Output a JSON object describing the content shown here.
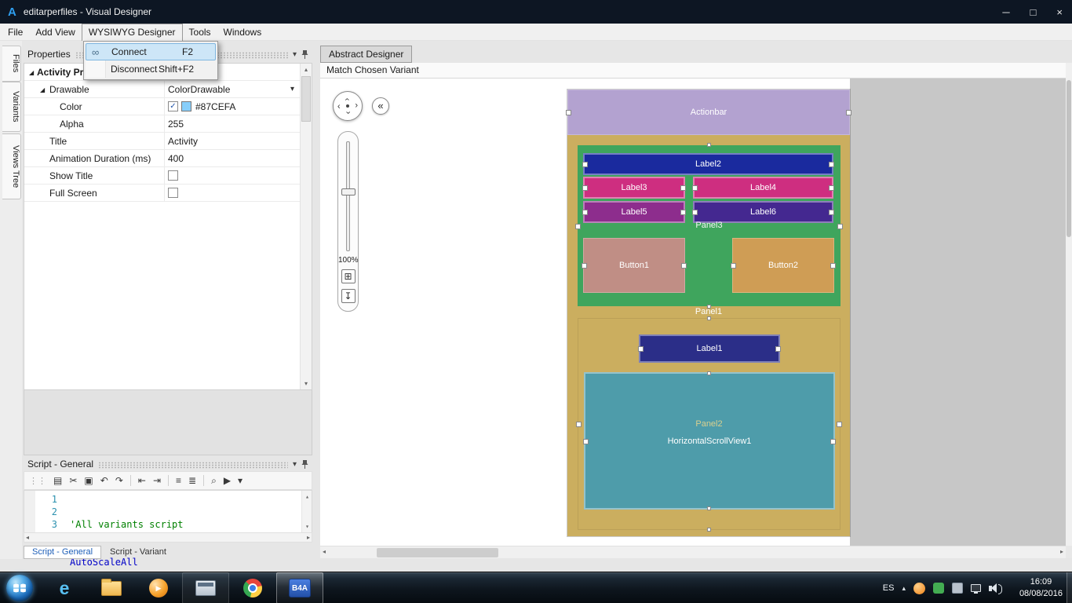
{
  "titlebar": {
    "logo": "A",
    "title": "editarperfiles - Visual Designer",
    "minimize": "─",
    "maximize": "□",
    "close": "×"
  },
  "menubar": {
    "items": [
      "File",
      "Add View",
      "WYSIWYG Designer",
      "Tools",
      "Windows"
    ]
  },
  "wysiwyg_menu": {
    "connect_label": "Connect",
    "connect_shortcut": "F2",
    "disconnect_label": "Disconnect",
    "disconnect_shortcut": "Shift+F2"
  },
  "side_tabs": {
    "files": "Files",
    "variants": "Variants",
    "views_tree": "Views Tree"
  },
  "properties": {
    "header": "Properties",
    "group": "Activity Properties",
    "drawable_label": "Drawable",
    "drawable_value": "ColorDrawable",
    "color_label": "Color",
    "color_value": "#87CEFA",
    "color_swatch": "#87CEFA",
    "alpha_label": "Alpha",
    "alpha_value": "255",
    "title_label": "Title",
    "title_value": "Activity",
    "anim_label": "Animation Duration (ms)",
    "anim_value": "400",
    "show_title_label": "Show Title",
    "full_screen_label": "Full Screen"
  },
  "script": {
    "header": "Script - General",
    "line1_num": "1",
    "line1_code": "'All variants script",
    "line2_num": "2",
    "line2_code": "AutoScaleAll",
    "line3_num": "3",
    "tab_general": "Script - General",
    "tab_variant": "Script - Variant"
  },
  "designer": {
    "tab": "Abstract Designer",
    "toolbar_label": "Match Chosen Variant",
    "zoom_label": "100%",
    "views": {
      "actionbar": {
        "label": "Actionbar",
        "color": "#b3a2d0"
      },
      "panel1": {
        "label": "Panel1",
        "color": "#cbae5f"
      },
      "panel2": {
        "label": "Panel2",
        "color": "#cbae5f"
      },
      "panel3": {
        "label": "Panel3",
        "color": "#3fa55d"
      },
      "label1": {
        "label": "Label1",
        "color": "#2b2e88"
      },
      "label2": {
        "label": "Label2",
        "color": "#1a2a9e"
      },
      "label3": {
        "label": "Label3",
        "color": "#ce2e80"
      },
      "label4": {
        "label": "Label4",
        "color": "#ce2e80"
      },
      "label5": {
        "label": "Label5",
        "color": "#8d2d8d"
      },
      "label6": {
        "label": "Label6",
        "color": "#442890"
      },
      "button1": {
        "label": "Button1",
        "color": "#c08e85"
      },
      "button2": {
        "label": "Button2",
        "color": "#cf9d55"
      },
      "hsv": {
        "label": "HorizontalScrollView1",
        "color": "#4e9caa"
      }
    }
  },
  "taskbar": {
    "b4a": "B4A",
    "language": "ES",
    "time": "16:09",
    "date": "08/08/2016"
  },
  "icons": {
    "menu_connect": "∞",
    "header_chevron": "▾",
    "expander": "◢",
    "combo_arrow": "▾",
    "check": "✓",
    "grip": "⋮⋮",
    "copy": "▤",
    "cut": "✂",
    "paste": "▣",
    "undo": "↶",
    "redo": "↷",
    "outdent": "⇤",
    "indent": "⇥",
    "comment": "≡",
    "uncomment": "≣",
    "search": "⌕",
    "run": "▶",
    "more": "▾",
    "nav_arrow": "›",
    "back": "«",
    "zoom_fit": "⊞",
    "zoom_import": "↧",
    "scroll_up": "▴",
    "scroll_down": "▾",
    "scroll_left": "◂",
    "scroll_right": "▸",
    "tray_expand": "▴",
    "ie": "e",
    "wmp_play": "▶"
  }
}
